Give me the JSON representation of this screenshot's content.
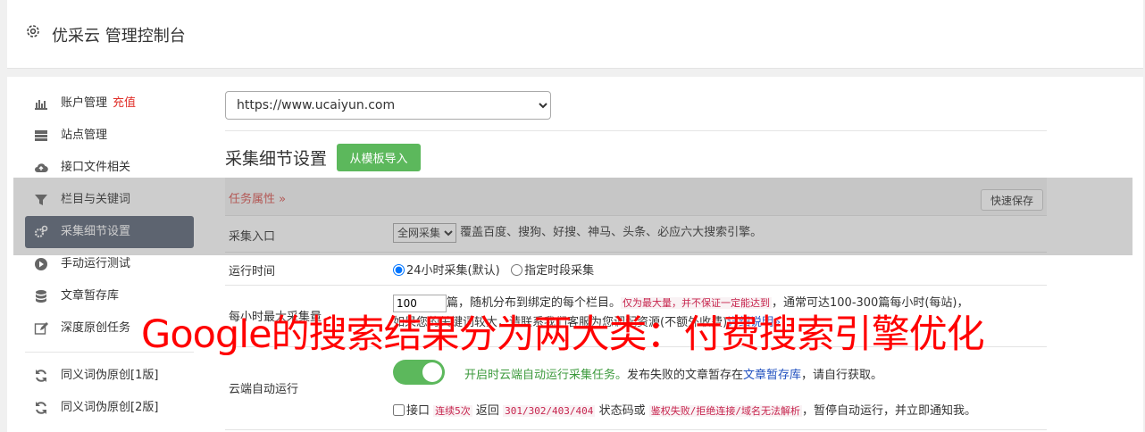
{
  "header": {
    "title": "优采云 管理控制台"
  },
  "sidebar": {
    "items": [
      {
        "label": "账户管理",
        "extra": "充值",
        "icon": "bar-chart-icon"
      },
      {
        "label": "站点管理",
        "icon": "server-icon"
      },
      {
        "label": "接口文件相关",
        "icon": "cloud-upload-icon"
      },
      {
        "label": "栏目与关键词",
        "icon": "filter-icon"
      },
      {
        "label": "采集细节设置",
        "icon": "gears-icon",
        "active": true
      },
      {
        "label": "手动运行测试",
        "icon": "play-circle-icon"
      },
      {
        "label": "文章暂存库",
        "icon": "database-icon"
      },
      {
        "label": "深度原创任务",
        "icon": "edit-icon"
      },
      {
        "label": "同义词伪原创[1版]",
        "icon": "refresh-icon"
      },
      {
        "label": "同义词伪原创[2版]",
        "icon": "refresh-icon"
      }
    ]
  },
  "main": {
    "site_select": "https://www.ucaiyun.com",
    "section_title": "采集细节设置",
    "import_button": "从模板导入",
    "task_props_label": "任务属性 »",
    "quick_save": "快速保存",
    "entry": {
      "label": "采集入口",
      "select": "全网采集",
      "desc": "覆盖百度、搜狗、好搜、神马、头条、必应六大搜索引擎。"
    },
    "run_time": {
      "label": "运行时间",
      "opt1": "24小时采集(默认)",
      "opt2": "指定时段采集"
    },
    "max": {
      "label": "每小时最大采集量",
      "value": "100",
      "text1": "篇，随机分布到绑定的每个栏目。",
      "warn": "仅为最大量，并不保证一定能达到",
      "text2": "，通常可达100-300篇每小时(每站)，",
      "text3": "如果您的关键词较大，请联系我们客服为您调配资源(不额外收费)",
      "link": "详细说明»"
    },
    "cloud": {
      "label": "云端自动运行",
      "desc_green": "开启时云端自动运行采集任务。",
      "desc_text": "发布失败的文章暂存在",
      "desc_link": "文章暂存库",
      "desc_tail": "，请自行获取。",
      "line2_a": "接口",
      "line2_warn1": "连续5次",
      "line2_b": "返回",
      "line2_codes": "301/302/403/404",
      "line2_c": "状态码或",
      "line2_warn2": "鉴权失败/拒绝连接/域名无法解析",
      "line2_d": "，暂停自动运行，并立即通知我。"
    }
  },
  "watermark": "Google的搜索结果分为两大类：付费搜索引擎优化",
  "colors": {
    "green": "#5cb85c",
    "active_bg": "#5b6577",
    "red": "#e0302a"
  }
}
